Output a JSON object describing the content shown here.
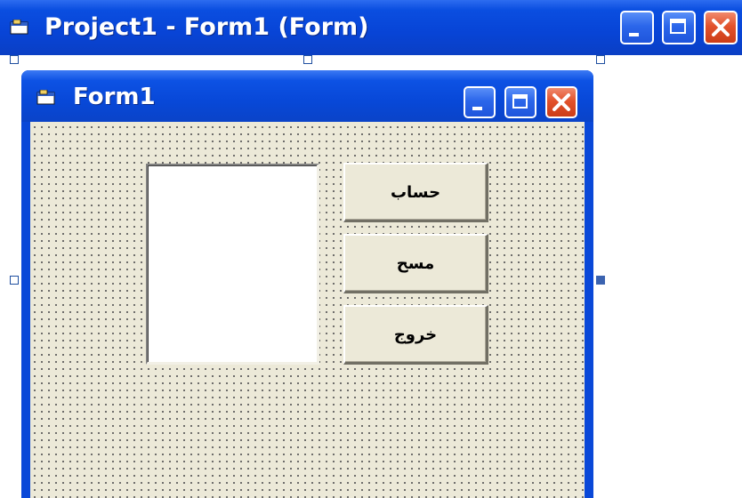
{
  "outer_window": {
    "title": "Project1 - Form1 (Form)",
    "icon": "form-icon",
    "caption_buttons": [
      "minimize-icon",
      "maximize-icon",
      "close-icon"
    ]
  },
  "form": {
    "title": "Form1",
    "icon": "form-icon",
    "caption_buttons": [
      "minimize-icon",
      "maximize-icon",
      "close-icon"
    ],
    "background_color": "#ece9d8",
    "buttons": [
      {
        "label": "حساب"
      },
      {
        "label": "مسح"
      },
      {
        "label": "خروج"
      }
    ]
  },
  "colors": {
    "titlebar_blue": "#0a4ee0",
    "close_red": "#e2522c",
    "selection_handle": "#3b63b0"
  }
}
